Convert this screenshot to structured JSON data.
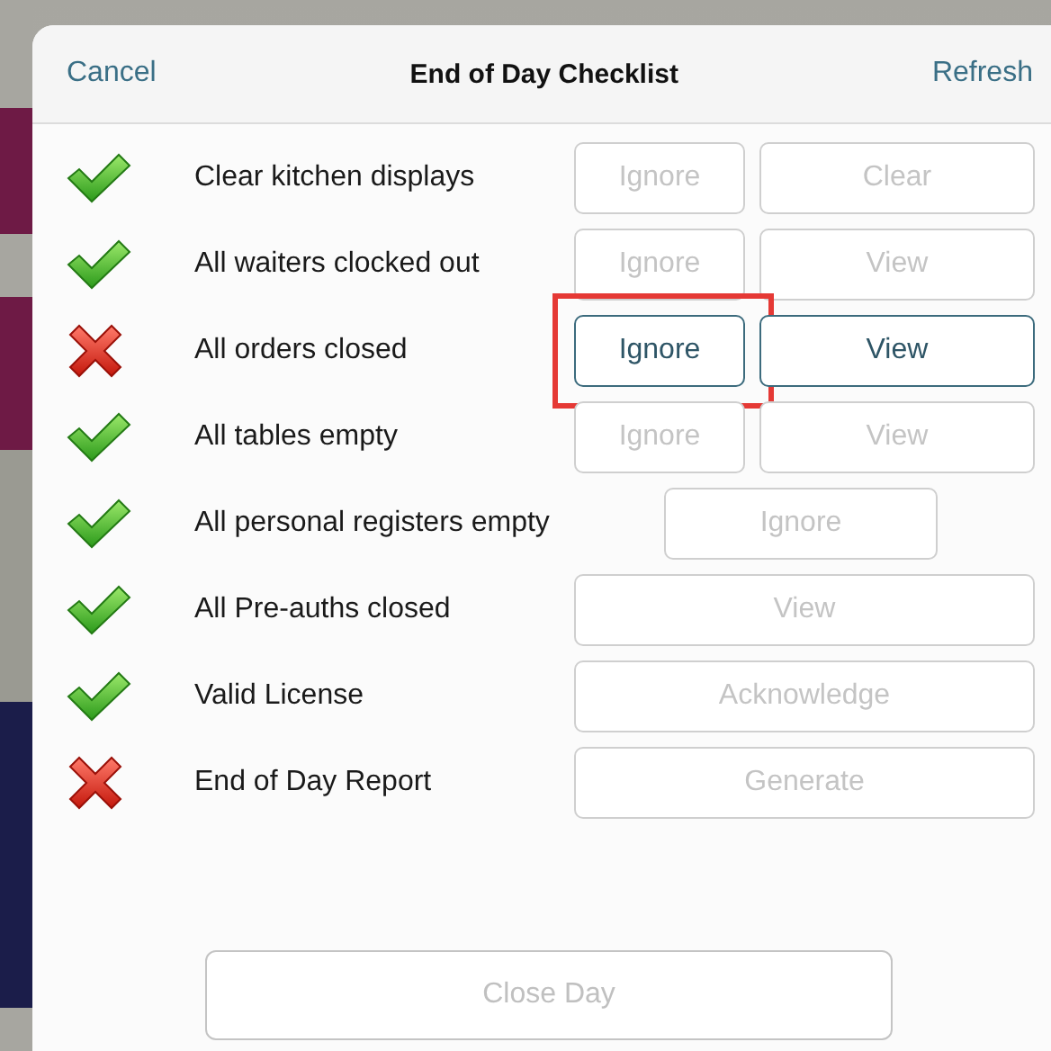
{
  "header": {
    "cancel": "Cancel",
    "title": "End of Day Checklist",
    "refresh": "Refresh"
  },
  "rows": [
    {
      "kind": "done",
      "label": "Clear kitchen displays",
      "buttons": [
        {
          "kind": "narrow",
          "label": "Ignore",
          "enabled": false,
          "highlighted": false
        },
        {
          "kind": "medium",
          "label": "Clear",
          "enabled": false,
          "highlighted": false
        }
      ]
    },
    {
      "kind": "done",
      "label": "All waiters clocked out",
      "buttons": [
        {
          "kind": "narrow",
          "label": "Ignore",
          "enabled": false,
          "highlighted": false
        },
        {
          "kind": "medium",
          "label": "View",
          "enabled": false,
          "highlighted": false
        }
      ]
    },
    {
      "kind": "failed",
      "label": "All orders closed",
      "buttons": [
        {
          "kind": "narrow",
          "label": "Ignore",
          "enabled": true,
          "highlighted": true
        },
        {
          "kind": "medium",
          "label": "View",
          "enabled": true,
          "highlighted": false
        }
      ]
    },
    {
      "kind": "done",
      "label": "All tables empty",
      "buttons": [
        {
          "kind": "narrow",
          "label": "Ignore",
          "enabled": false,
          "highlighted": false
        },
        {
          "kind": "medium",
          "label": "View",
          "enabled": false,
          "highlighted": false
        }
      ]
    },
    {
      "kind": "done",
      "label": "All personal registers empty",
      "buttons": [
        {
          "kind": "offset",
          "label": "Ignore",
          "enabled": false,
          "highlighted": false
        }
      ]
    },
    {
      "kind": "done",
      "label": "All Pre-auths closed",
      "buttons": [
        {
          "kind": "wide",
          "label": "View",
          "enabled": false,
          "highlighted": false
        }
      ]
    },
    {
      "kind": "done",
      "label": "Valid License",
      "buttons": [
        {
          "kind": "wide",
          "label": "Acknowledge",
          "enabled": false,
          "highlighted": false
        }
      ]
    },
    {
      "kind": "failed",
      "label": "End of Day Report",
      "buttons": [
        {
          "kind": "wide",
          "label": "Generate",
          "enabled": false,
          "highlighted": false
        }
      ]
    }
  ],
  "close_button": {
    "label": "Close Day",
    "enabled": false
  }
}
